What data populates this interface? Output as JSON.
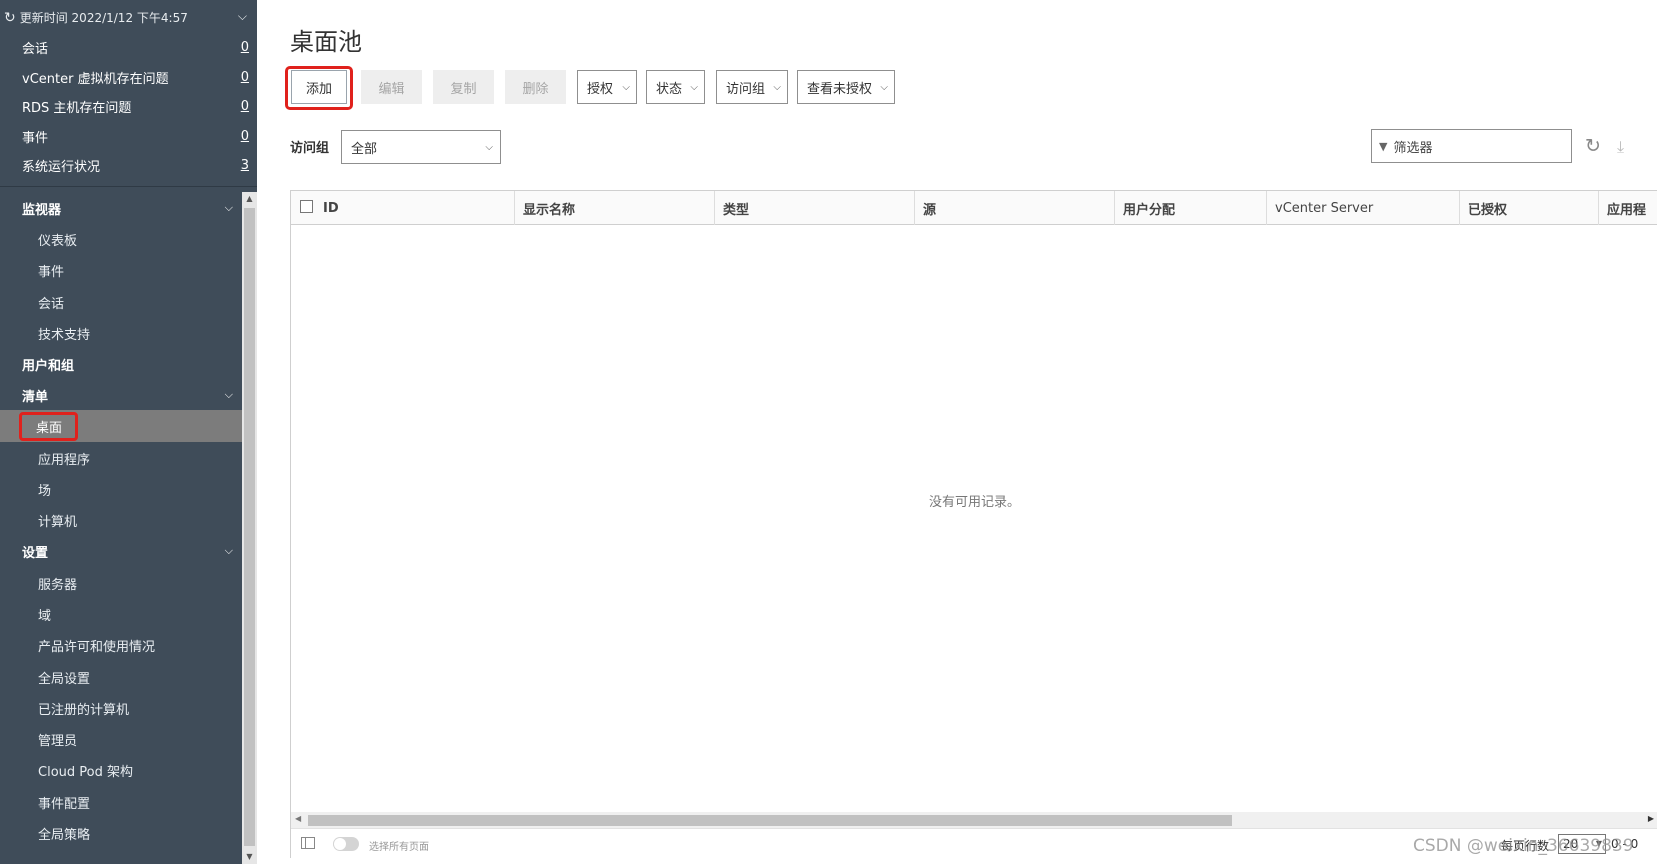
{
  "sidebar": {
    "update_label": "更新时间 2022/1/12 下午4:57",
    "stats": [
      {
        "label": "会话",
        "count": "0"
      },
      {
        "label": "vCenter 虚拟机存在问题",
        "count": "0"
      },
      {
        "label": "RDS 主机存在问题",
        "count": "0"
      },
      {
        "label": "事件",
        "count": "0"
      },
      {
        "label": "系统运行状况",
        "count": "3"
      }
    ],
    "nav": {
      "monitor": {
        "label": "监视器",
        "items": [
          "仪表板",
          "事件",
          "会话",
          "技术支持"
        ]
      },
      "users": {
        "label": "用户和组"
      },
      "inventory": {
        "label": "清单",
        "items": [
          "桌面",
          "应用程序",
          "场",
          "计算机"
        ]
      },
      "settings": {
        "label": "设置",
        "items": [
          "服务器",
          "域",
          "产品许可和使用情况",
          "全局设置",
          "已注册的计算机",
          "管理员",
          "Cloud Pod 架构",
          "事件配置",
          "全局策略"
        ]
      }
    }
  },
  "main": {
    "title": "桌面池",
    "toolbar": {
      "add": "添加",
      "edit": "编辑",
      "copy": "复制",
      "delete": "删除",
      "entitle": "授权",
      "status": "状态",
      "access_group": "访问组",
      "view_unentitled": "查看未授权"
    },
    "access_group_label": "访问组",
    "access_group_value": "全部",
    "filter_placeholder": "筛选器",
    "columns": [
      "ID",
      "显示名称",
      "类型",
      "源",
      "用户分配",
      "vCenter Server",
      "已授权",
      "应用程"
    ],
    "empty_message": "没有可用记录。",
    "footer": {
      "select_all_pages": "选择所有页面",
      "rows_per_page_label": "每页行数",
      "rows_per_page": "20",
      "range": "0 - 0"
    }
  },
  "watermark": "CSDN @weixin_36639839",
  "colors": {
    "sidebar_bg": "#3f4c59",
    "active_item_bg": "#7c7c7c",
    "highlight": "#e0211c"
  }
}
